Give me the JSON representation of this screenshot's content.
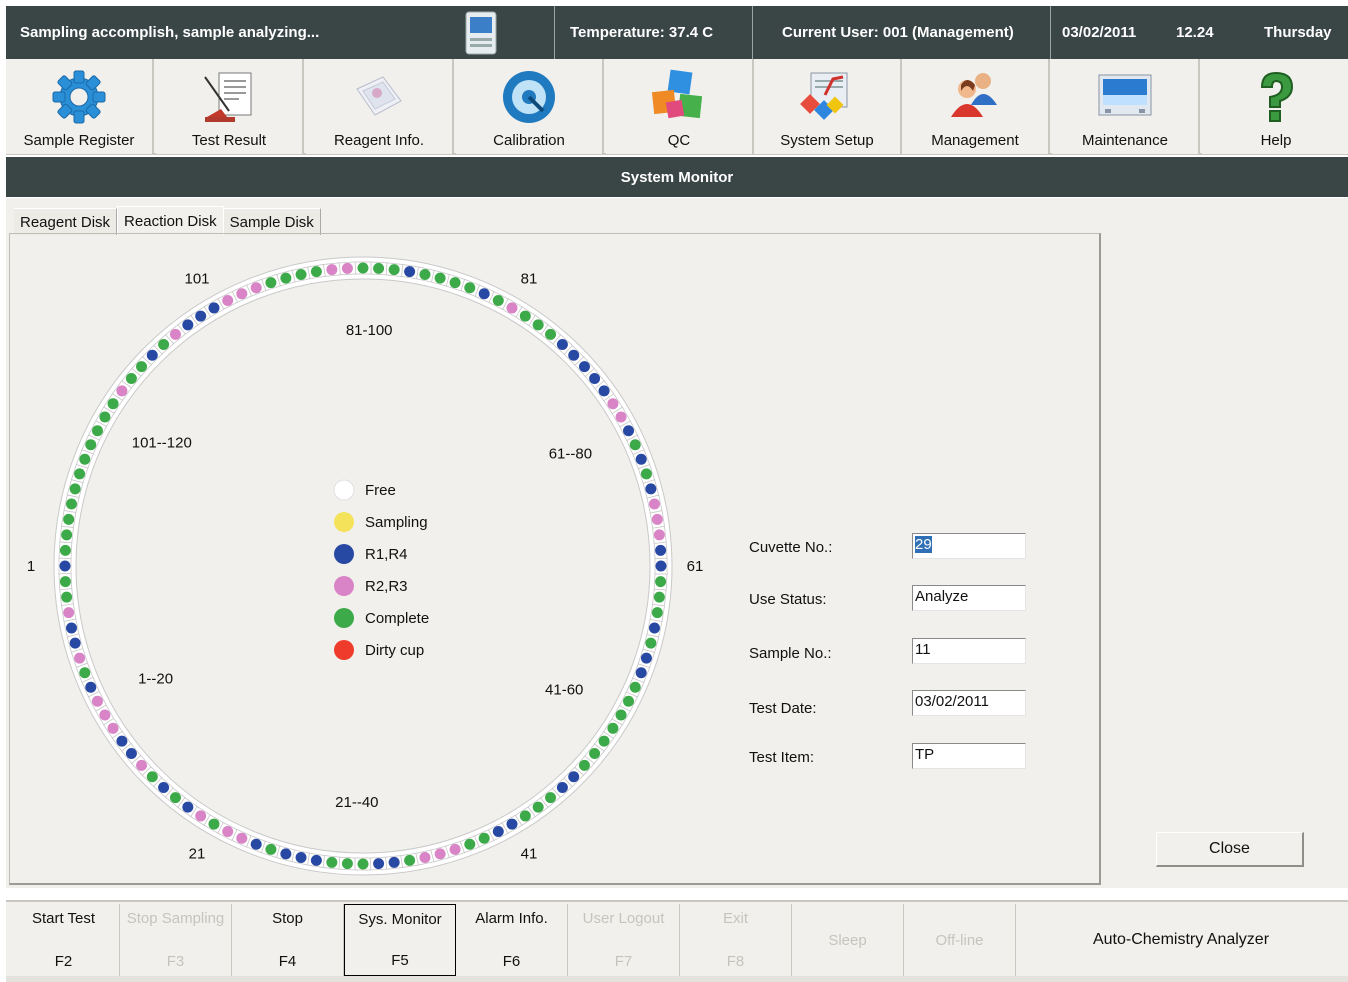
{
  "status": {
    "message": "Sampling accomplish, sample analyzing...",
    "temperature": "Temperature: 37.4 C",
    "user": "Current User: 001 (Management)",
    "date": "03/02/2011",
    "time": "12.24",
    "day": "Thursday"
  },
  "toolbar": [
    {
      "label": "Sample Register",
      "icon": "gear-icon"
    },
    {
      "label": "Test Result",
      "icon": "report-icon"
    },
    {
      "label": "Reagent Info.",
      "icon": "reagent-icon"
    },
    {
      "label": "Calibration",
      "icon": "calibration-icon"
    },
    {
      "label": "QC",
      "icon": "qc-cubes-icon"
    },
    {
      "label": "System Setup",
      "icon": "setup-icon"
    },
    {
      "label": "Management",
      "icon": "users-icon"
    },
    {
      "label": "Maintenance",
      "icon": "monitor-icon"
    },
    {
      "label": "Help",
      "icon": "help-icon"
    }
  ],
  "title": "System Monitor",
  "tabs": [
    {
      "label": "Reagent Disk",
      "active": false
    },
    {
      "label": "Reaction Disk",
      "active": true
    },
    {
      "label": "Sample Disk",
      "active": false
    }
  ],
  "disk": {
    "total_cuvettes": 120,
    "ring_labels": [
      "1",
      "21",
      "41",
      "61",
      "81",
      "101"
    ],
    "segment_labels": [
      "1--20",
      "21--40",
      "41-60",
      "61--80",
      "81-100",
      "101--120"
    ],
    "legend": [
      {
        "label": "Free",
        "color": "#ffffff"
      },
      {
        "label": "Sampling",
        "color": "#f4e35a"
      },
      {
        "label": "R1,R4",
        "color": "#2849a3"
      },
      {
        "label": "R2,R3",
        "color": "#d884c6"
      },
      {
        "label": "Complete",
        "color": "#3daa4a"
      },
      {
        "label": "Dirty cup",
        "color": "#ef3b2c"
      }
    ],
    "cuvettes": {
      "R1R4": [
        1,
        5,
        6,
        9,
        13,
        14,
        17,
        19,
        24,
        26,
        27,
        28,
        32,
        33,
        40,
        41,
        45,
        46,
        54,
        55,
        57,
        61,
        62,
        66,
        68,
        70,
        73,
        74,
        75,
        76,
        77,
        83,
        88,
        101,
        102,
        103,
        106
      ],
      "R2R3": [
        4,
        7,
        10,
        11,
        12,
        15,
        20,
        22,
        23,
        35,
        36,
        37,
        63,
        64,
        65,
        71,
        72,
        81,
        92,
        93,
        98,
        99,
        100,
        104,
        109
      ],
      "Complete": [
        2,
        3,
        8,
        16,
        18,
        21,
        25,
        29,
        30,
        31,
        34,
        38,
        39,
        42,
        43,
        44,
        47,
        48,
        49,
        50,
        51,
        52,
        53,
        56,
        58,
        59,
        60,
        67,
        69,
        78,
        79,
        80,
        82,
        84,
        85,
        86,
        87,
        89,
        90,
        91,
        94,
        95,
        96,
        97,
        105,
        107,
        108,
        110,
        111,
        112,
        113,
        114,
        115,
        116,
        117,
        118,
        119,
        120
      ]
    }
  },
  "fields": {
    "cuvette_no": {
      "label": "Cuvette No.:",
      "value": "29"
    },
    "use_status": {
      "label": "Use Status:",
      "value": "Analyze"
    },
    "sample_no": {
      "label": "Sample No.:",
      "value": "11"
    },
    "test_date": {
      "label": "Test Date:",
      "value": "03/02/2011"
    },
    "test_item": {
      "label": "Test Item:",
      "value": "TP"
    }
  },
  "close_label": "Close",
  "fkeys": [
    {
      "label": "Start Test",
      "key": "F2",
      "state": "enabled"
    },
    {
      "label": "Stop Sampling",
      "key": "F3",
      "state": "disabled"
    },
    {
      "label": "Stop",
      "key": "F4",
      "state": "enabled"
    },
    {
      "label": "Sys. Monitor",
      "key": "F5",
      "state": "active"
    },
    {
      "label": "Alarm Info.",
      "key": "F6",
      "state": "enabled"
    },
    {
      "label": "User Logout",
      "key": "F7",
      "state": "disabled"
    },
    {
      "label": "Exit",
      "key": "F8",
      "state": "disabled"
    },
    {
      "label": "Sleep",
      "key": "",
      "state": "disabled"
    },
    {
      "label": "Off-line",
      "key": "",
      "state": "disabled"
    }
  ],
  "app_name": "Auto-Chemistry Analyzer"
}
